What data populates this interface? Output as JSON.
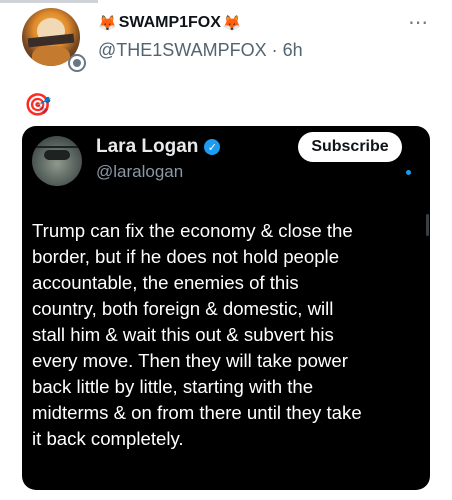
{
  "post": {
    "display_name": "SWAMP1FOX",
    "fox_emoji": "🦊",
    "handle": "@THE1SWAMPFOX",
    "separator": "·",
    "time": "6h",
    "more_icon": "⋯",
    "emoji_line": "🎯"
  },
  "quoted": {
    "name": "Lara Logan",
    "verified_mark": "✓",
    "handle": "@laralogan",
    "subscribe_label": "Subscribe",
    "text_lines": [
      "Trump can fix the economy & close the",
      "border, but if he does not hold people",
      "accountable, the enemies of this",
      "country, both foreign & domestic,  will",
      "stall him & wait this out & subvert his",
      "every move. Then they will take power",
      "back little by little, starting with the",
      "midterms & on from there until they take",
      "it back completely."
    ]
  },
  "icons": {
    "more": "more-dots-icon",
    "verified": "verified-check-icon",
    "target": "target-emoji-icon"
  },
  "colors": {
    "verified_blue": "#1d9bf0",
    "card_background": "#000000",
    "handle_gray": "#536471"
  }
}
